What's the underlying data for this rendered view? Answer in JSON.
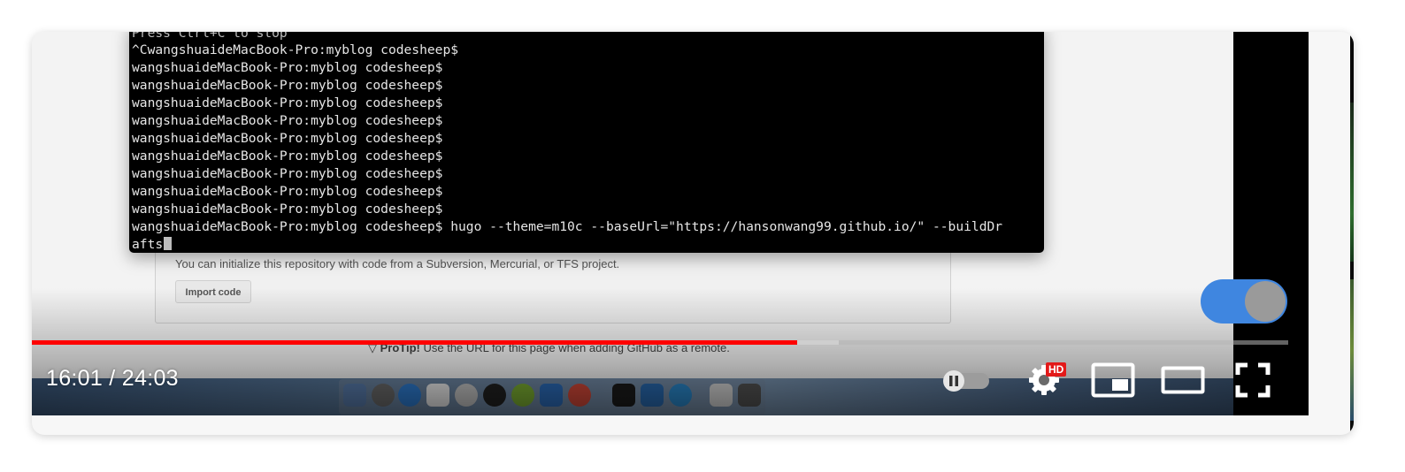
{
  "terminal": {
    "lines": [
      "Press Ctrl+C to stop",
      "^CwangshuaideMacBook-Pro:myblog codesheep$",
      "wangshuaideMacBook-Pro:myblog codesheep$",
      "wangshuaideMacBook-Pro:myblog codesheep$",
      "wangshuaideMacBook-Pro:myblog codesheep$",
      "wangshuaideMacBook-Pro:myblog codesheep$",
      "wangshuaideMacBook-Pro:myblog codesheep$",
      "wangshuaideMacBook-Pro:myblog codesheep$",
      "wangshuaideMacBook-Pro:myblog codesheep$",
      "wangshuaideMacBook-Pro:myblog codesheep$",
      "wangshuaideMacBook-Pro:myblog codesheep$",
      "wangshuaideMacBook-Pro:myblog codesheep$ hugo --theme=m10c --baseUrl=\"https://hansonwang99.github.io/\" --buildDr",
      "afts"
    ]
  },
  "github": {
    "import_text": "You can initialize this repository with code from a Subversion, Mercurial, or TFS project.",
    "import_button": "Import code",
    "protip_label": "ProTip!",
    "protip_text": " Use the URL for this page when adding GitHub as a remote."
  },
  "player": {
    "time_display": "16:01 / 24:03",
    "progress_played_percent": 60.9,
    "progress_buffered_percent": 64.2,
    "hd_badge": "HD",
    "autoplay_on": true,
    "colors": {
      "progress": "#ff0000",
      "toggle": "#3f86e0",
      "hd": "#e31919"
    },
    "icons": [
      "pause-icon",
      "settings-icon",
      "miniplayer-icon",
      "theater-mode-icon",
      "fullscreen-icon"
    ]
  }
}
